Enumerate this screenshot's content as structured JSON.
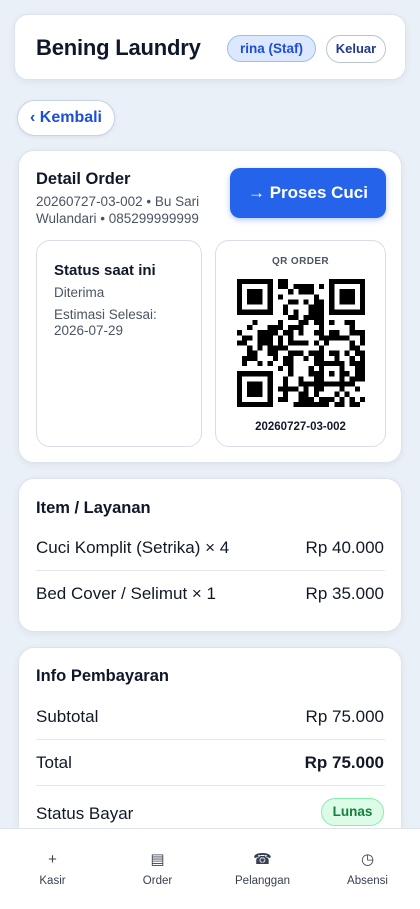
{
  "header": {
    "brand": "Bening Laundry",
    "staff_badge": "rina (Staf)",
    "logout_label": "Keluar"
  },
  "back_label": "‹ Kembali",
  "detail": {
    "title": "Detail Order",
    "subtitle": "20260727-03-002 • Bu Sari Wulandari • 085299999999",
    "process_button": "→ Proses Cuci",
    "status_title": "Status saat ini",
    "status_value": "Diterima",
    "estimate": "Estimasi Selesai: 2026-07-29",
    "qr_label": "QR ORDER",
    "qr_code_text": "20260727-03-002"
  },
  "items": {
    "title": "Item / Layanan",
    "rows": [
      {
        "name": "Cuci Komplit (Setrika) × 4",
        "price": "Rp 40.000"
      },
      {
        "name": "Bed Cover / Selimut × 1",
        "price": "Rp 35.000"
      }
    ]
  },
  "payment": {
    "title": "Info Pembayaran",
    "subtotal_label": "Subtotal",
    "subtotal_value": "Rp 75.000",
    "total_label": "Total",
    "total_value": "Rp 75.000",
    "status_label": "Status Bayar",
    "status_badge": "Lunas"
  },
  "nav": [
    {
      "icon": "plus-icon",
      "glyph": "+",
      "label": "Kasir"
    },
    {
      "icon": "list-icon",
      "glyph": "▤",
      "label": "Order"
    },
    {
      "icon": "phone-icon",
      "glyph": "☎",
      "label": "Pelanggan"
    },
    {
      "icon": "clock-icon",
      "glyph": "◷",
      "label": "Absensi"
    }
  ],
  "colors": {
    "primary": "#2563eb",
    "background": "#eaf0f7",
    "paid_green": "#15803d"
  }
}
